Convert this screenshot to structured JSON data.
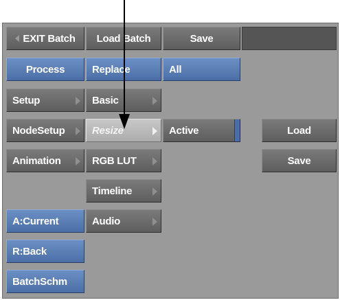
{
  "menu": {
    "exit_batch": "EXIT Batch",
    "load_batch": "Load Batch",
    "save_top": "Save",
    "process": "Process",
    "replace": "Replace",
    "all": "All",
    "setup": "Setup",
    "basic": "Basic",
    "nodesetup": "NodeSetup",
    "resize": "Resize",
    "active": "Active",
    "load": "Load",
    "animation": "Animation",
    "rgb_lut": "RGB LUT",
    "save_right": "Save",
    "timeline": "Timeline",
    "a_current": "A:Current",
    "audio": "Audio",
    "r_back": "R:Back",
    "batchschm": "BatchSchm"
  },
  "colors": {
    "panel": "#9a9a9a",
    "button_gray": "#6b6b6b",
    "button_blue": "#5a7db5",
    "button_selected": "#bababa",
    "pointer": "#000000"
  },
  "icons": [
    "chevron-left-icon",
    "submenu-arrow-icon",
    "pointer-arrow-icon"
  ]
}
